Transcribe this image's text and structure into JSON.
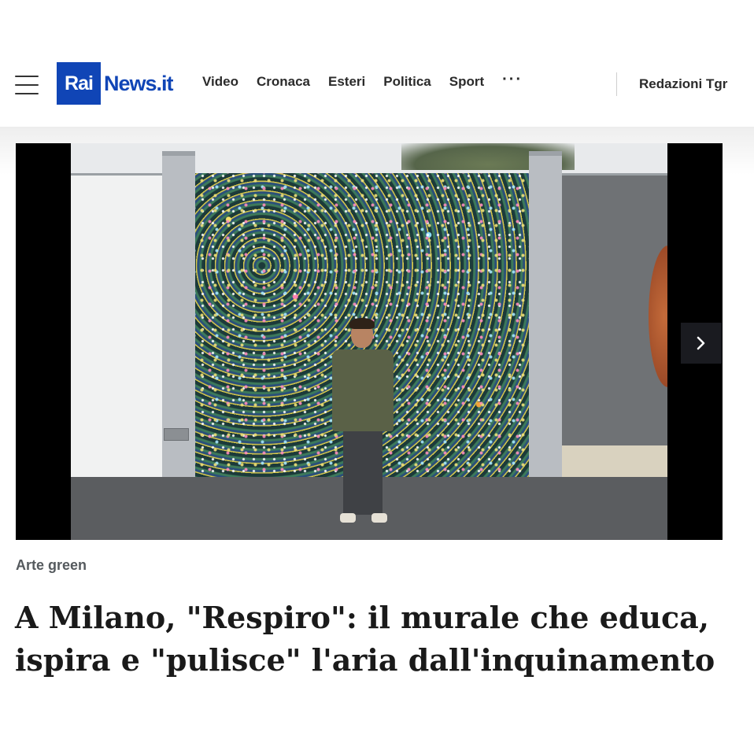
{
  "header": {
    "menu_icon": "hamburger-menu-icon",
    "logo": {
      "rai": "Rai",
      "news": "News.it"
    },
    "nav": [
      "Video",
      "Cronaca",
      "Esteri",
      "Politica",
      "Sport"
    ],
    "more_icon": "more-dots-icon",
    "more_label": "···",
    "redazioni": "Redazioni Tgr"
  },
  "carousel": {
    "next_icon": "chevron-right-icon"
  },
  "article": {
    "category": "Arte green",
    "title": "A Milano, \"Respiro\": il murale che educa, ispira e \"pulisce\" l'aria dall'inquinamento"
  },
  "colors": {
    "brand": "#1045b6",
    "text": "#1a1a1a",
    "category": "#555a5e"
  }
}
